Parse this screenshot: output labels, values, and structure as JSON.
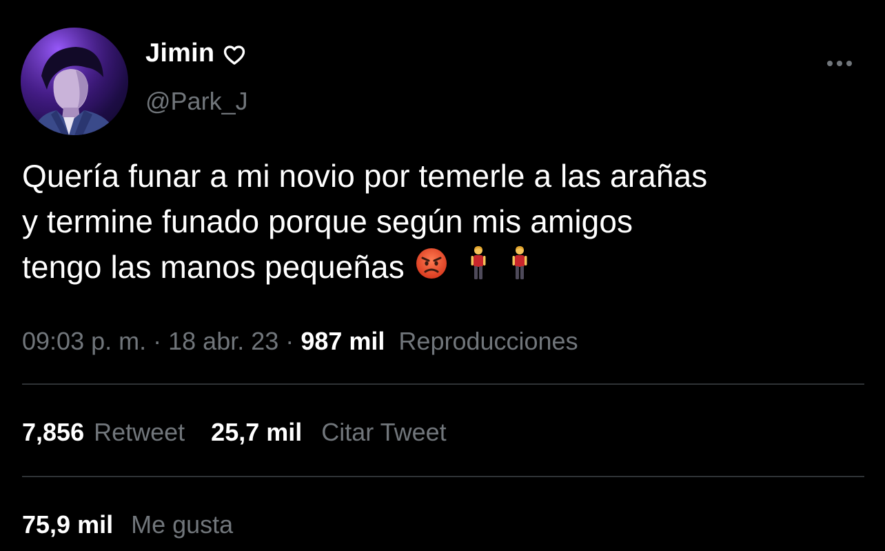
{
  "author": {
    "name": "Jimin",
    "handle": "@Park_J"
  },
  "tweet": {
    "lines": [
      "Quería funar a mi novio por temerle a las arañas",
      "y termine funado porque según mis amigos",
      "tengo las manos pequeñas"
    ],
    "emojis": [
      "angry-face-emoji",
      "standing-person-emoji",
      "standing-person-emoji"
    ]
  },
  "meta": {
    "time": "09:03 p. m.",
    "separator": "·",
    "date": "18 abr. 23",
    "views_count": "987 mil",
    "views_label": "Reproducciones"
  },
  "stats": {
    "retweets_count": "7,856",
    "retweets_label": "Retweet",
    "quotes_count": "25,7 mil",
    "quotes_label": "Citar Tweet",
    "likes_count": "75,9 mil",
    "likes_label": "Me gusta"
  },
  "colors": {
    "background": "#000000",
    "primary_text": "#ffffff",
    "secondary_text": "#71767b",
    "divider": "#2f3336"
  }
}
